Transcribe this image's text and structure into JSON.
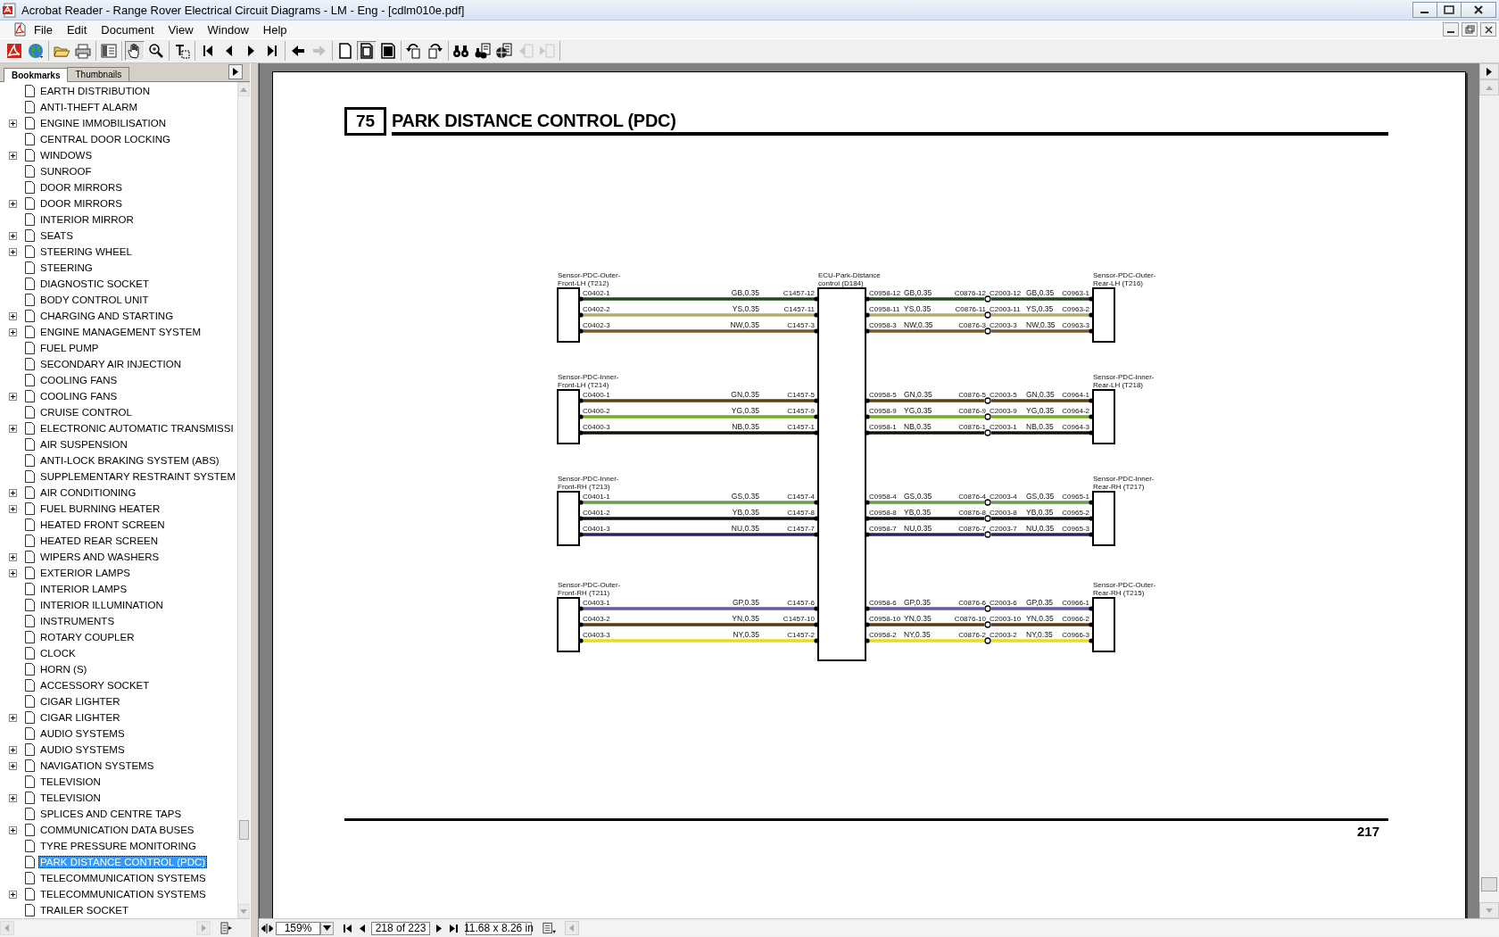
{
  "window": {
    "title": "Acrobat Reader - Range Rover Electrical Circuit Diagrams - LM - Eng - [cdlm010e.pdf]"
  },
  "menu": [
    "File",
    "Edit",
    "Document",
    "View",
    "Window",
    "Help"
  ],
  "toolbar_groups": [
    {
      "buttons": [
        {
          "kind": "logo",
          "pressed": false,
          "disabled": false
        },
        {
          "kind": "globe",
          "pressed": false,
          "disabled": false
        }
      ]
    },
    {
      "buttons": [
        {
          "kind": "open",
          "pressed": false,
          "disabled": false
        },
        {
          "kind": "print",
          "pressed": false,
          "disabled": false
        }
      ]
    },
    {
      "buttons": [
        {
          "kind": "panel",
          "pressed": false,
          "disabled": false
        }
      ]
    },
    {
      "buttons": [
        {
          "kind": "hand",
          "pressed": true,
          "disabled": false
        },
        {
          "kind": "zoom",
          "pressed": false,
          "disabled": false
        }
      ]
    },
    {
      "buttons": [
        {
          "kind": "textselect",
          "pressed": false,
          "disabled": false
        }
      ]
    },
    {
      "buttons": [
        {
          "kind": "first",
          "pressed": false,
          "disabled": false
        },
        {
          "kind": "prev",
          "pressed": false,
          "disabled": false
        },
        {
          "kind": "next",
          "pressed": false,
          "disabled": false
        },
        {
          "kind": "last",
          "pressed": false,
          "disabled": false
        }
      ]
    },
    {
      "buttons": [
        {
          "kind": "back",
          "pressed": false,
          "disabled": false
        },
        {
          "kind": "forward",
          "pressed": false,
          "disabled": true
        }
      ]
    },
    {
      "buttons": [
        {
          "kind": "actualsize",
          "pressed": false,
          "disabled": false
        },
        {
          "kind": "fitpage",
          "pressed": true,
          "disabled": false
        },
        {
          "kind": "fitwidth",
          "pressed": false,
          "disabled": false
        }
      ]
    },
    {
      "buttons": [
        {
          "kind": "rotateleft",
          "pressed": false,
          "disabled": false
        },
        {
          "kind": "rotateright",
          "pressed": false,
          "disabled": false
        }
      ]
    },
    {
      "buttons": [
        {
          "kind": "find",
          "pressed": false,
          "disabled": false
        },
        {
          "kind": "search",
          "pressed": false,
          "disabled": false
        },
        {
          "kind": "webdoc",
          "pressed": false,
          "disabled": false
        },
        {
          "kind": "prevresult",
          "pressed": false,
          "disabled": true
        },
        {
          "kind": "nextresult",
          "pressed": false,
          "disabled": true
        }
      ]
    }
  ],
  "navigation_panel": {
    "tabs": [
      {
        "label": "Bookmarks",
        "selected": true
      },
      {
        "label": "Thumbnails",
        "selected": false
      }
    ],
    "bookmarks": [
      {
        "label": "EARTH DISTRIBUTION",
        "has_children": false,
        "selected": false
      },
      {
        "label": "ANTI-THEFT ALARM",
        "has_children": false,
        "selected": false
      },
      {
        "label": "ENGINE IMMOBILISATION",
        "has_children": true,
        "selected": false
      },
      {
        "label": "CENTRAL DOOR LOCKING",
        "has_children": false,
        "selected": false
      },
      {
        "label": "WINDOWS",
        "has_children": true,
        "selected": false
      },
      {
        "label": "SUNROOF",
        "has_children": false,
        "selected": false
      },
      {
        "label": "DOOR MIRRORS",
        "has_children": false,
        "selected": false
      },
      {
        "label": "DOOR MIRRORS",
        "has_children": true,
        "selected": false
      },
      {
        "label": "INTERIOR MIRROR",
        "has_children": false,
        "selected": false
      },
      {
        "label": "SEATS",
        "has_children": true,
        "selected": false
      },
      {
        "label": "STEERING WHEEL",
        "has_children": true,
        "selected": false
      },
      {
        "label": "STEERING",
        "has_children": false,
        "selected": false
      },
      {
        "label": "DIAGNOSTIC SOCKET",
        "has_children": false,
        "selected": false
      },
      {
        "label": "BODY CONTROL UNIT",
        "has_children": false,
        "selected": false
      },
      {
        "label": "CHARGING AND STARTING",
        "has_children": true,
        "selected": false
      },
      {
        "label": "ENGINE MANAGEMENT SYSTEM",
        "has_children": true,
        "selected": false
      },
      {
        "label": "FUEL PUMP",
        "has_children": false,
        "selected": false
      },
      {
        "label": "SECONDARY AIR INJECTION",
        "has_children": false,
        "selected": false
      },
      {
        "label": "COOLING FANS",
        "has_children": false,
        "selected": false
      },
      {
        "label": "COOLING FANS",
        "has_children": true,
        "selected": false
      },
      {
        "label": "CRUISE CONTROL",
        "has_children": false,
        "selected": false
      },
      {
        "label": "ELECTRONIC AUTOMATIC TRANSMISSI",
        "has_children": true,
        "selected": false
      },
      {
        "label": "AIR SUSPENSION",
        "has_children": false,
        "selected": false
      },
      {
        "label": "ANTI-LOCK BRAKING SYSTEM (ABS)",
        "has_children": false,
        "selected": false
      },
      {
        "label": "SUPPLEMENTARY RESTRAINT SYSTEM",
        "has_children": false,
        "selected": false
      },
      {
        "label": "AIR CONDITIONING",
        "has_children": true,
        "selected": false
      },
      {
        "label": "FUEL BURNING HEATER",
        "has_children": true,
        "selected": false
      },
      {
        "label": "HEATED FRONT SCREEN",
        "has_children": false,
        "selected": false
      },
      {
        "label": "HEATED REAR SCREEN",
        "has_children": false,
        "selected": false
      },
      {
        "label": "WIPERS AND WASHERS",
        "has_children": true,
        "selected": false
      },
      {
        "label": "EXTERIOR LAMPS",
        "has_children": true,
        "selected": false
      },
      {
        "label": "INTERIOR LAMPS",
        "has_children": false,
        "selected": false
      },
      {
        "label": "INTERIOR ILLUMINATION",
        "has_children": false,
        "selected": false
      },
      {
        "label": "INSTRUMENTS",
        "has_children": false,
        "selected": false
      },
      {
        "label": "ROTARY COUPLER",
        "has_children": false,
        "selected": false
      },
      {
        "label": "CLOCK",
        "has_children": false,
        "selected": false
      },
      {
        "label": "HORN (S)",
        "has_children": false,
        "selected": false
      },
      {
        "label": "ACCESSORY SOCKET",
        "has_children": false,
        "selected": false
      },
      {
        "label": "CIGAR LIGHTER",
        "has_children": false,
        "selected": false
      },
      {
        "label": "CIGAR LIGHTER",
        "has_children": true,
        "selected": false
      },
      {
        "label": "AUDIO SYSTEMS",
        "has_children": false,
        "selected": false
      },
      {
        "label": "AUDIO SYSTEMS",
        "has_children": true,
        "selected": false
      },
      {
        "label": "NAVIGATION SYSTEMS",
        "has_children": true,
        "selected": false
      },
      {
        "label": "TELEVISION",
        "has_children": false,
        "selected": false
      },
      {
        "label": "TELEVISION",
        "has_children": true,
        "selected": false
      },
      {
        "label": "SPLICES AND CENTRE TAPS",
        "has_children": false,
        "selected": false
      },
      {
        "label": "COMMUNICATION DATA BUSES",
        "has_children": true,
        "selected": false
      },
      {
        "label": "TYRE PRESSURE MONITORING",
        "has_children": false,
        "selected": false
      },
      {
        "label": "PARK DISTANCE CONTROL (PDC)",
        "has_children": false,
        "selected": true
      },
      {
        "label": "TELECOMMUNICATION SYSTEMS",
        "has_children": false,
        "selected": false
      },
      {
        "label": "TELECOMMUNICATION SYSTEMS",
        "has_children": true,
        "selected": false
      },
      {
        "label": "TRAILER SOCKET",
        "has_children": false,
        "selected": false
      }
    ]
  },
  "document": {
    "page": {
      "section_number": "75",
      "title": "PARK DISTANCE CONTROL (PDC)",
      "page_number": "217",
      "diagram": {
        "ecu": [
          "ECU-Park-Distance",
          "control (D184)"
        ],
        "groups": [
          {
            "front_sensor": [
              "Sensor-PDC-Outer-",
              "Front-LH (T212)"
            ],
            "rear_sensor": [
              "Sensor-PDC-Outer-",
              "Rear-LH (T216)"
            ],
            "wires": [
              {
                "front_pin": "C0402-1",
                "front_code": "GB,0.35",
                "ecu_front_pin": "C1457-12",
                "ecu_rear_pin": "C0958-12",
                "middle_code": "GB,0.35",
                "splice_in": "C0876-12",
                "splice_out": "C2003-12",
                "rear_code": "GB,0.35",
                "rear_pin": "C0963-1",
                "color": "#1f4a1f"
              },
              {
                "front_pin": "C0402-2",
                "front_code": "YS,0.35",
                "ecu_front_pin": "C1457-11",
                "ecu_rear_pin": "C0958-11",
                "middle_code": "YS,0.35",
                "splice_in": "C0876-11",
                "splice_out": "C2003-11",
                "rear_code": "YS,0.35",
                "rear_pin": "C0963-2",
                "color": "#b5ad6e"
              },
              {
                "front_pin": "C0402-3",
                "front_code": "NW,0.35",
                "ecu_front_pin": "C1457-3",
                "ecu_rear_pin": "C0958-3",
                "middle_code": "NW,0.35",
                "splice_in": "C0876-3",
                "splice_out": "C2003-3",
                "rear_code": "NW,0.35",
                "rear_pin": "C0963-3",
                "color": "#7a5a2c"
              }
            ]
          },
          {
            "front_sensor": [
              "Sensor-PDC-Inner-",
              "Front-LH (T214)"
            ],
            "rear_sensor": [
              "Sensor-PDC-Inner-",
              "Rear-LH (T218)"
            ],
            "wires": [
              {
                "front_pin": "C0400-1",
                "front_code": "GN,0.35",
                "ecu_front_pin": "C1457-5",
                "ecu_rear_pin": "C0958-5",
                "middle_code": "GN,0.35",
                "splice_in": "C0876-5",
                "splice_out": "C2003-5",
                "rear_code": "GN,0.35",
                "rear_pin": "C0964-1",
                "color": "#5a4214"
              },
              {
                "front_pin": "C0400-2",
                "front_code": "YG,0.35",
                "ecu_front_pin": "C1457-9",
                "ecu_rear_pin": "C0958-9",
                "middle_code": "YG,0.35",
                "splice_in": "C0876-9",
                "splice_out": "C2003-9",
                "rear_code": "YG,0.35",
                "rear_pin": "C0964-2",
                "color": "#6fb11e"
              },
              {
                "front_pin": "C0400-3",
                "front_code": "NB,0.35",
                "ecu_front_pin": "C1457-1",
                "ecu_rear_pin": "C0958-1",
                "middle_code": "NB,0.35",
                "splice_in": "C0876-1",
                "splice_out": "C2003-1",
                "rear_code": "NB,0.35",
                "rear_pin": "C0964-3",
                "color": "#151008"
              }
            ]
          },
          {
            "front_sensor": [
              "Sensor-PDC-Inner-",
              "Front-RH (T213)"
            ],
            "rear_sensor": [
              "Sensor-PDC-Inner-",
              "Rear-RH (T217)"
            ],
            "wires": [
              {
                "front_pin": "C0401-1",
                "front_code": "GS,0.35",
                "ecu_front_pin": "C1457-4",
                "ecu_rear_pin": "C0958-4",
                "middle_code": "GS,0.35",
                "splice_in": "C0876-4",
                "splice_out": "C2003-4",
                "rear_code": "GS,0.35",
                "rear_pin": "C0965-1",
                "color": "#6a9a52"
              },
              {
                "front_pin": "C0401-2",
                "front_code": "YB,0.35",
                "ecu_front_pin": "C1457-8",
                "ecu_rear_pin": "C0958-8",
                "middle_code": "YB,0.35",
                "splice_in": "C0876-8",
                "splice_out": "C2003-8",
                "rear_code": "YB,0.35",
                "rear_pin": "C0965-2",
                "color": "#101010"
              },
              {
                "front_pin": "C0401-3",
                "front_code": "NU,0.35",
                "ecu_front_pin": "C1457-7",
                "ecu_rear_pin": "C0958-7",
                "middle_code": "NU,0.35",
                "splice_in": "C0876-7",
                "splice_out": "C2003-7",
                "rear_code": "NU,0.35",
                "rear_pin": "C0965-3",
                "color": "#2a2260"
              }
            ]
          },
          {
            "front_sensor": [
              "Sensor-PDC-Outer-",
              "Front-RH (T211)"
            ],
            "rear_sensor": [
              "Sensor-PDC-Outer-",
              "Rear-RH (T215)"
            ],
            "wires": [
              {
                "front_pin": "C0403-1",
                "front_code": "GP,0.35",
                "ecu_front_pin": "C1457-6",
                "ecu_rear_pin": "C0958-6",
                "middle_code": "GP,0.35",
                "splice_in": "C0876-6",
                "splice_out": "C2003-6",
                "rear_code": "GP,0.35",
                "rear_pin": "C0966-1",
                "color": "#6a58a8"
              },
              {
                "front_pin": "C0403-2",
                "front_code": "YN,0.35",
                "ecu_front_pin": "C1457-10",
                "ecu_rear_pin": "C0958-10",
                "middle_code": "YN,0.35",
                "splice_in": "C0876-10",
                "splice_out": "C2003-10",
                "rear_code": "YN,0.35",
                "rear_pin": "C0966-2",
                "color": "#5a3a12"
              },
              {
                "front_pin": "C0403-3",
                "front_code": "NY,0.35",
                "ecu_front_pin": "C1457-2",
                "ecu_rear_pin": "C0958-2",
                "middle_code": "NY,0.35",
                "splice_in": "C0876-2",
                "splice_out": "C2003-2",
                "rear_code": "NY,0.35",
                "rear_pin": "C0966-3",
                "color": "#e6de1c"
              }
            ]
          }
        ]
      }
    }
  },
  "status_bar": {
    "zoom": "159%",
    "page": "218 of 223",
    "page_size": "11.68 x 8.26 in"
  }
}
